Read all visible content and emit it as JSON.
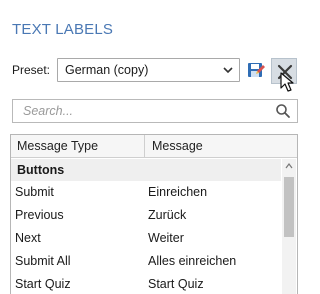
{
  "panel": {
    "title": "TEXT LABELS"
  },
  "preset": {
    "label": "Preset:",
    "selected": "German (copy)"
  },
  "search": {
    "placeholder": "Search..."
  },
  "table": {
    "columns": [
      "Message Type",
      "Message"
    ],
    "group": "Buttons",
    "rows": [
      {
        "type": "Submit",
        "message": "Einreichen"
      },
      {
        "type": "Previous",
        "message": "Zurück"
      },
      {
        "type": "Next",
        "message": "Weiter"
      },
      {
        "type": "Submit All",
        "message": "Alles einreichen"
      },
      {
        "type": "Start Quiz",
        "message": "Start Quiz"
      }
    ]
  },
  "colors": {
    "title": "#4a78b4",
    "delete_bg": "#d7dde3",
    "save_icon": "#2f6db5",
    "save_accent": "#d9534f"
  },
  "icons": {
    "chevron": "chevron-down-icon",
    "save": "save-icon",
    "delete": "close-icon",
    "search": "search-icon",
    "cursor": "mouse-pointer-icon"
  }
}
